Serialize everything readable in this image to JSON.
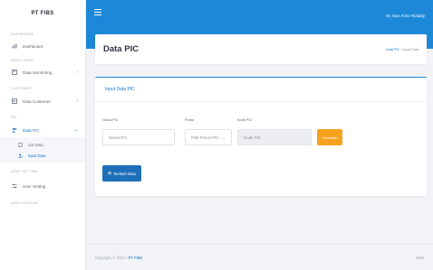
{
  "brand": "PT FIBS",
  "sidebar": {
    "sections": [
      "DASHBOARD",
      "MONITORING",
      "CUSTOMER",
      "PIC",
      "USER SETTING",
      "USER APLIKASI"
    ],
    "items": {
      "dashboard": "Dashboard",
      "monitoring": "Data Monitoring",
      "customer": "Data Customer",
      "pic": "Data PIC",
      "user_setting": "User Setting"
    },
    "sub_items": {
      "list": "List Data",
      "input": "Input Data"
    }
  },
  "topbar": {
    "greeting": "Hi, Ivan Ariez Rizaldy"
  },
  "header": {
    "title": "Data PIC",
    "breadcrumb_link": "Data PIC",
    "breadcrumb_sep": "/",
    "breadcrumb_current": "Input Data"
  },
  "form": {
    "title": "Input Data PIC",
    "nama_label": "Nama PIC",
    "nama_placeholder": "Nama PIC",
    "posisi_label": "Posisi",
    "posisi_value": "Pilih Posisi PIC",
    "kode_label": "Kode PIC",
    "kode_placeholder": "Kode PIC",
    "generate_label": "Generate",
    "add_label": "Tambah Data"
  },
  "footer": {
    "copyright": "Copyright © 2021 •",
    "company": "PT FIBS",
    "right": "Beta"
  },
  "colors": {
    "primary": "#1d88d8",
    "accent": "#f7a21e",
    "button": "#1d6fb8"
  }
}
